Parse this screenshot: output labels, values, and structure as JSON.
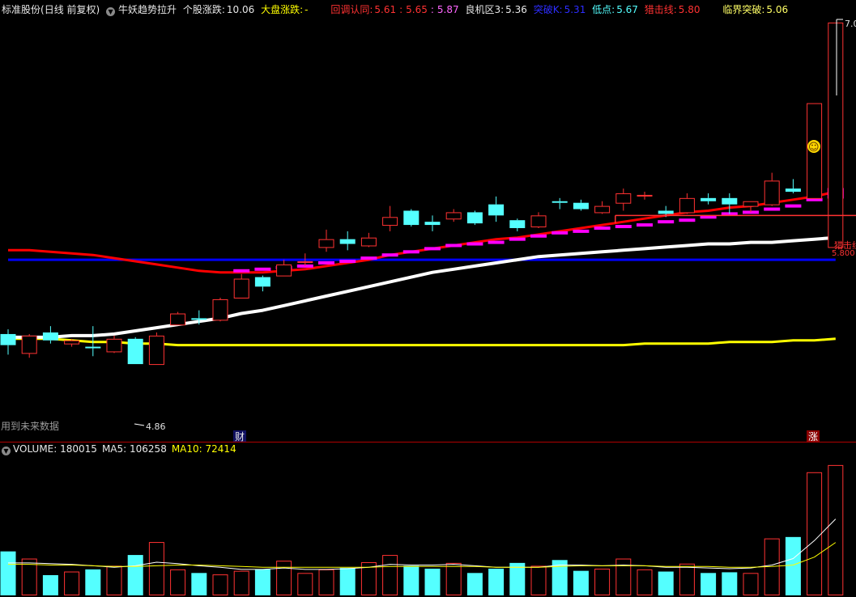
{
  "header": {
    "stock_name": "标准股份",
    "period": "(日线 前复权)",
    "indicator_name": "牛妖趋势拉升",
    "stock_change_label": "个股涨跌:",
    "stock_change_value": "10.06",
    "market_change_label": "大盘涨跌:",
    "market_change_value": "-",
    "pullback_label": "回调认同:",
    "pullback_v1": "5.61",
    "pullback_v2": "5.65",
    "pullback_v3": "5.87",
    "buyzone_label": "良机区3:",
    "buyzone_value": "5.36",
    "breakk_label": "突破K:",
    "breakk_value": "5.31",
    "low_label": "低点:",
    "low_value": "5.67",
    "hunt_label": "猎击线:",
    "hunt_value": "5.80",
    "critical_label": "临界突破:",
    "critical_value": "5.06"
  },
  "notes": {
    "future_data": "用到未来数据",
    "min_label": "4.86",
    "hunt_line_label": "猎击线",
    "hunt_line_value": "5.800",
    "top_value": "7.0",
    "finance_badge": "财",
    "limit_up_badge": "涨",
    "smiley": "☺"
  },
  "volume_header": {
    "volume_label": "VOLUME:",
    "volume_value": "180015",
    "ma5_label": "MA5:",
    "ma5_value": "106258",
    "ma10_label": "MA10:",
    "ma10_value": "72414"
  },
  "colors": {
    "up": "#ff3232",
    "down": "#54ffff",
    "ma_red": "#ff0000",
    "ma_blue": "#0000ff",
    "ma_white": "#ffffff",
    "ma_yellow": "#ffff00",
    "magenta": "#ff00ff",
    "divider": "#c00000"
  },
  "chart_data": {
    "type": "candlestick",
    "price_range": [
      4.4,
      7.05
    ],
    "volume_range": [
      0,
      190000
    ],
    "candles": [
      {
        "o": 5.05,
        "c": 4.98,
        "h": 5.08,
        "l": 4.92,
        "v": 60000
      },
      {
        "o": 4.93,
        "c": 5.04,
        "h": 5.05,
        "l": 4.9,
        "v": 50000
      },
      {
        "o": 5.06,
        "c": 5.01,
        "h": 5.1,
        "l": 4.99,
        "v": 27000
      },
      {
        "o": 4.99,
        "c": 5.01,
        "h": 5.02,
        "l": 4.97,
        "v": 32000
      },
      {
        "o": 4.97,
        "c": 4.96,
        "h": 5.1,
        "l": 4.91,
        "v": 35000
      },
      {
        "o": 4.94,
        "c": 5.02,
        "h": 5.04,
        "l": 4.93,
        "v": 40000
      },
      {
        "o": 5.02,
        "c": 4.86,
        "h": 5.03,
        "l": 4.86,
        "v": 55000
      },
      {
        "o": 4.86,
        "c": 5.04,
        "h": 5.06,
        "l": 4.86,
        "v": 73000
      },
      {
        "o": 5.11,
        "c": 5.18,
        "h": 5.19,
        "l": 5.11,
        "v": 35000
      },
      {
        "o": 5.15,
        "c": 5.14,
        "h": 5.2,
        "l": 5.11,
        "v": 30000
      },
      {
        "o": 5.14,
        "c": 5.27,
        "h": 5.28,
        "l": 5.13,
        "v": 28000
      },
      {
        "o": 5.28,
        "c": 5.4,
        "h": 5.43,
        "l": 5.28,
        "v": 33000
      },
      {
        "o": 5.41,
        "c": 5.35,
        "h": 5.42,
        "l": 5.32,
        "v": 35000
      },
      {
        "o": 5.42,
        "c": 5.49,
        "h": 5.52,
        "l": 5.42,
        "v": 47000
      },
      {
        "o": 5.51,
        "c": 5.51,
        "h": 5.56,
        "l": 5.48,
        "v": 30000
      },
      {
        "o": 5.6,
        "c": 5.65,
        "h": 5.71,
        "l": 5.57,
        "v": 35000
      },
      {
        "o": 5.65,
        "c": 5.62,
        "h": 5.7,
        "l": 5.58,
        "v": 37000
      },
      {
        "o": 5.61,
        "c": 5.66,
        "h": 5.69,
        "l": 5.6,
        "v": 45000
      },
      {
        "o": 5.74,
        "c": 5.79,
        "h": 5.86,
        "l": 5.7,
        "v": 55000
      },
      {
        "o": 5.83,
        "c": 5.74,
        "h": 5.84,
        "l": 5.73,
        "v": 40000
      },
      {
        "o": 5.76,
        "c": 5.74,
        "h": 5.8,
        "l": 5.7,
        "v": 36000
      },
      {
        "o": 5.78,
        "c": 5.82,
        "h": 5.84,
        "l": 5.76,
        "v": 44000
      },
      {
        "o": 5.82,
        "c": 5.75,
        "h": 5.83,
        "l": 5.74,
        "v": 30000
      },
      {
        "o": 5.87,
        "c": 5.8,
        "h": 5.92,
        "l": 5.76,
        "v": 36000
      },
      {
        "o": 5.77,
        "c": 5.72,
        "h": 5.78,
        "l": 5.7,
        "v": 44000
      },
      {
        "o": 5.73,
        "c": 5.8,
        "h": 5.82,
        "l": 5.72,
        "v": 40000
      },
      {
        "o": 5.89,
        "c": 5.88,
        "h": 5.91,
        "l": 5.84,
        "v": 48000
      },
      {
        "o": 5.88,
        "c": 5.84,
        "h": 5.9,
        "l": 5.83,
        "v": 33000
      },
      {
        "o": 5.82,
        "c": 5.86,
        "h": 5.89,
        "l": 5.81,
        "v": 36000
      },
      {
        "o": 5.88,
        "c": 5.94,
        "h": 5.97,
        "l": 5.83,
        "v": 50000
      },
      {
        "o": 5.93,
        "c": 5.93,
        "h": 5.95,
        "l": 5.9,
        "v": 35000
      },
      {
        "o": 5.83,
        "c": 5.81,
        "h": 5.86,
        "l": 5.79,
        "v": 32000
      },
      {
        "o": 5.82,
        "c": 5.91,
        "h": 5.94,
        "l": 5.81,
        "v": 43000
      },
      {
        "o": 5.91,
        "c": 5.89,
        "h": 5.94,
        "l": 5.87,
        "v": 30000
      },
      {
        "o": 5.91,
        "c": 5.87,
        "h": 5.94,
        "l": 5.81,
        "v": 31000
      },
      {
        "o": 5.86,
        "c": 5.89,
        "h": 5.89,
        "l": 5.82,
        "v": 30000
      },
      {
        "o": 5.87,
        "c": 6.02,
        "h": 6.07,
        "l": 5.86,
        "v": 78000
      },
      {
        "o": 5.97,
        "c": 5.95,
        "h": 6.03,
        "l": 5.94,
        "v": 80000
      },
      {
        "o": 5.91,
        "c": 6.51,
        "h": 6.51,
        "l": 5.91,
        "v": 170000
      },
      {
        "o": 5.6,
        "c": 7.02,
        "h": 7.02,
        "l": 5.6,
        "v": 180015
      }
    ],
    "ma_red": [
      5.58,
      5.58,
      5.57,
      5.56,
      5.55,
      5.53,
      5.51,
      5.49,
      5.47,
      5.45,
      5.44,
      5.44,
      5.44,
      5.45,
      5.46,
      5.48,
      5.5,
      5.52,
      5.55,
      5.57,
      5.59,
      5.61,
      5.63,
      5.65,
      5.66,
      5.68,
      5.7,
      5.72,
      5.74,
      5.76,
      5.78,
      5.8,
      5.82,
      5.83,
      5.85,
      5.86,
      5.88,
      5.9,
      5.92,
      5.95
    ],
    "ma_blue": [
      5.52,
      5.52,
      5.52,
      5.52,
      5.52,
      5.52,
      5.52,
      5.52,
      5.52,
      5.52,
      5.52,
      5.52,
      5.52,
      5.52,
      5.52,
      5.52,
      5.52,
      5.52,
      5.52,
      5.52,
      5.52,
      5.52,
      5.52,
      5.52,
      5.52,
      5.52,
      5.52,
      5.52,
      5.52,
      5.52,
      5.52,
      5.52,
      5.52,
      5.52,
      5.52,
      5.52,
      5.52,
      5.52,
      5.52,
      5.52
    ],
    "ma_white": [
      5.03,
      5.03,
      5.03,
      5.04,
      5.04,
      5.05,
      5.07,
      5.09,
      5.11,
      5.13,
      5.15,
      5.18,
      5.2,
      5.23,
      5.26,
      5.29,
      5.32,
      5.35,
      5.38,
      5.41,
      5.44,
      5.46,
      5.48,
      5.5,
      5.52,
      5.54,
      5.55,
      5.56,
      5.57,
      5.58,
      5.59,
      5.6,
      5.61,
      5.62,
      5.62,
      5.63,
      5.63,
      5.64,
      5.65,
      5.66
    ],
    "ma_yellow": [
      5.02,
      5.02,
      5.02,
      5.01,
      5.0,
      5.0,
      4.99,
      4.99,
      4.98,
      4.98,
      4.98,
      4.98,
      4.98,
      4.98,
      4.98,
      4.98,
      4.98,
      4.98,
      4.98,
      4.98,
      4.98,
      4.98,
      4.98,
      4.98,
      4.98,
      4.98,
      4.98,
      4.98,
      4.98,
      4.98,
      4.99,
      4.99,
      4.99,
      4.99,
      5.0,
      5.0,
      5.0,
      5.01,
      5.01,
      5.02
    ],
    "magenta_steps": [
      null,
      null,
      null,
      null,
      null,
      null,
      null,
      null,
      null,
      null,
      null,
      5.45,
      5.46,
      5.47,
      5.48,
      5.5,
      5.51,
      5.53,
      5.55,
      5.57,
      5.59,
      5.61,
      5.62,
      5.63,
      5.65,
      5.67,
      5.69,
      5.7,
      5.72,
      5.73,
      5.74,
      5.76,
      5.77,
      5.79,
      5.81,
      5.82,
      5.84,
      5.86,
      5.9,
      5.94
    ],
    "hunt_line": 5.8,
    "hunt_line_start": 29,
    "vol_ma5": [
      44000,
      44000,
      43000,
      42000,
      40000,
      38000,
      40000,
      45000,
      43000,
      40000,
      38000,
      35000,
      35000,
      37000,
      35000,
      35000,
      36000,
      38000,
      42000,
      41000,
      41000,
      42000,
      40000,
      38000,
      38000,
      38000,
      41000,
      41000,
      40000,
      41000,
      40000,
      38000,
      38000,
      37000,
      36000,
      37000,
      41000,
      50000,
      75000,
      105000
    ],
    "vol_ma10": [
      42000,
      42000,
      41000,
      41000,
      40000,
      39000,
      39000,
      40000,
      41000,
      41000,
      40000,
      39000,
      38000,
      38000,
      38000,
      38000,
      38000,
      38000,
      39000,
      39000,
      39000,
      39000,
      39000,
      38000,
      38000,
      38000,
      39000,
      40000,
      40000,
      40000,
      40000,
      39000,
      39000,
      39000,
      38000,
      38000,
      39000,
      41000,
      52000,
      72414
    ]
  }
}
